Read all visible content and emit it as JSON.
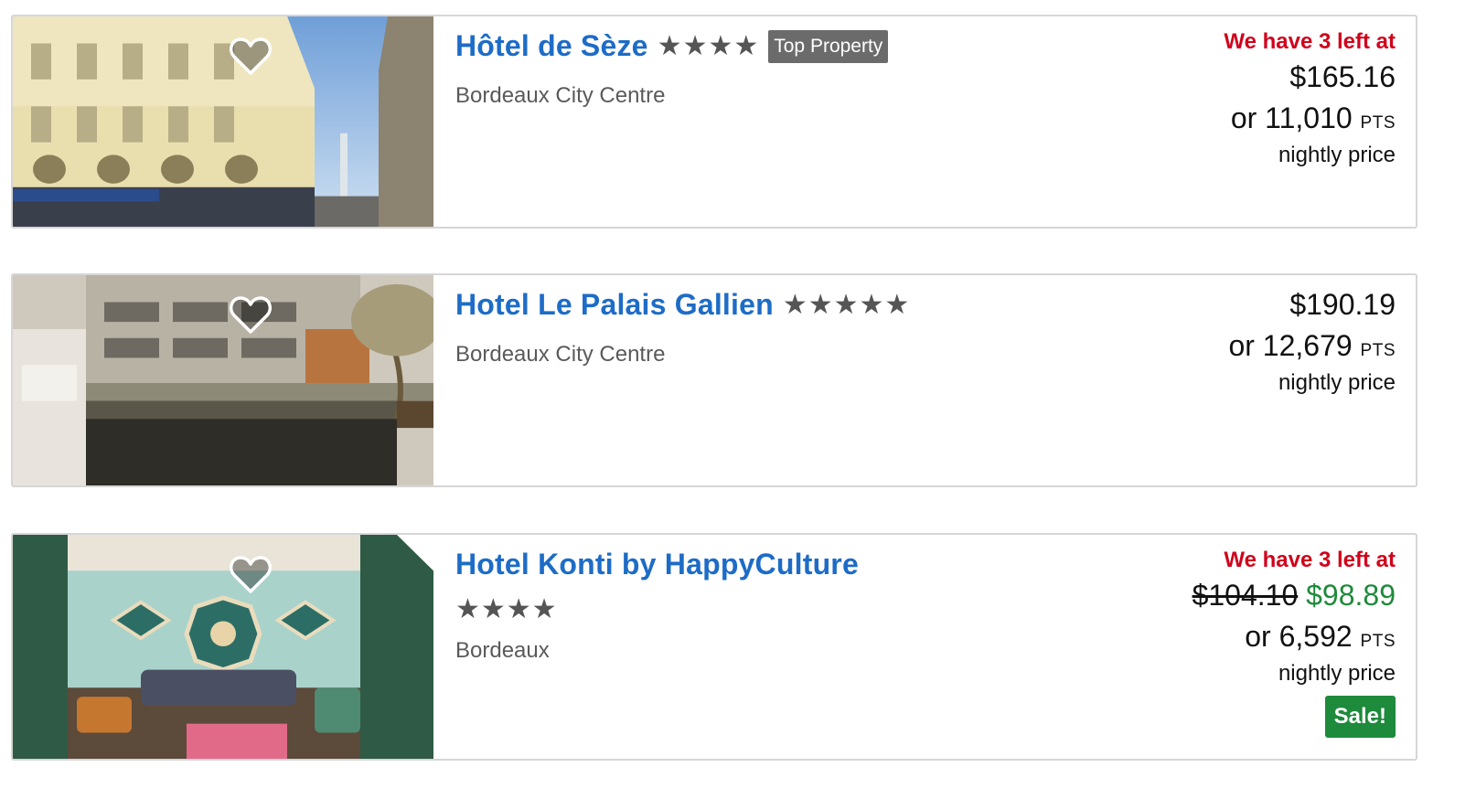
{
  "hotels": [
    {
      "name": "Hôtel de Sèze",
      "stars": "★★★★",
      "badge": "Top Property",
      "location": "Bordeaux City Centre",
      "urgency": "We have 3 left at",
      "price": "$165.16",
      "points_prefix": "or 11,010",
      "points_unit": "PTS",
      "price_note": "nightly price"
    },
    {
      "name": "Hotel Le Palais Gallien",
      "stars": "★★★★★",
      "location": "Bordeaux City Centre",
      "price": "$190.19",
      "points_prefix": "or 12,679",
      "points_unit": "PTS",
      "price_note": "nightly price"
    },
    {
      "name": "Hotel Konti by HappyCulture",
      "stars": "★★★★",
      "location": "Bordeaux",
      "urgency": "We have 3 left at",
      "original_price": "$104.10",
      "sale_price": "$98.89",
      "points_prefix": "or 6,592",
      "points_unit": "PTS",
      "price_note": "nightly price",
      "sale_label": "Sale!"
    }
  ],
  "colors": {
    "link_blue": "#1d6cc7",
    "urgency_red": "#d0021b",
    "sale_green": "#1e8a3c",
    "badge_gray": "#6b6b6b"
  },
  "icons": {
    "favorite": "heart-outline-icon",
    "gallery": "photo-gallery-icon"
  }
}
